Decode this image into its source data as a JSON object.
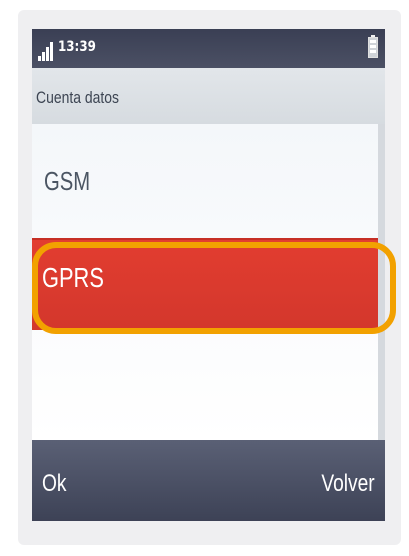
{
  "status_bar": {
    "time": "13:39",
    "signal_icon": "signal-bars-icon",
    "battery_icon": "battery-icon"
  },
  "header": {
    "title": "Cuenta datos"
  },
  "list": {
    "items": [
      {
        "label": "GSM",
        "selected": false
      },
      {
        "label": "GPRS",
        "selected": true
      }
    ]
  },
  "softkeys": {
    "left_label": "Ok",
    "right_label": "Volver"
  },
  "colors": {
    "selection": "#d9392d",
    "highlight_ring": "#f2a100",
    "bars": "#474c61"
  }
}
